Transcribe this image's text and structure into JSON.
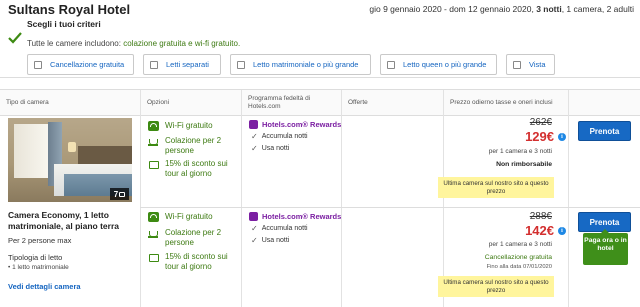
{
  "header": {
    "hotel_name": "Sultans Royal Hotel",
    "dates": "gio 9 gennaio 2020 - dom 12 gennaio 2020,",
    "nights": "3 notti",
    "rooms_guests": ", 1 camera, 2 adulti"
  },
  "criteria": {
    "title": "Scegli i tuoi criteri",
    "subtitle_prefix": "Tutte le camere includono:",
    "subtitle_included": "colazione gratuita e wi-fi gratuito.",
    "filters": [
      {
        "label": "Cancellazione gratuita"
      },
      {
        "label": "Letti separati"
      },
      {
        "label": "Letto matrimoniale o più grande"
      },
      {
        "label": "Letto queen o più grande"
      },
      {
        "label": "Vista"
      }
    ]
  },
  "table": {
    "headers": {
      "room_type": "Tipo di camera",
      "options": "Opzioni",
      "loyalty": "Programma fedeltà di Hotels.com",
      "offers": "Offerte",
      "price": "Prezzo odierno tasse e oneri inclusi"
    }
  },
  "room": {
    "photo_count": "7",
    "name": "Camera Economy, 1 letto matrimoniale, al piano terra",
    "people": "Per 2 persone max",
    "bed_type_title": "Tipologia di letto",
    "bed_type_item": "• 1 letto matrimoniale",
    "details_link": "Vedi dettagli camera"
  },
  "offers": [
    {
      "options": [
        "Wi-Fi gratuito",
        "Colazione per 2 persone",
        "15% di sconto sui tour al giorno"
      ],
      "loyalty_name": "Hotels.com® Rewards",
      "loyalty_items": [
        "Accumula notti",
        "Usa notti"
      ],
      "old_price": "262€",
      "new_price": "129€",
      "per": "per 1 camera e 3 notti",
      "note": "Non rimborsabile",
      "last_room": "Ultima camera sul nostro sito a questo prezzo",
      "button": "Prenota"
    },
    {
      "options": [
        "Wi-Fi gratuito",
        "Colazione per 2 persone",
        "15% di sconto sui tour al giorno"
      ],
      "loyalty_name": "Hotels.com® Rewards",
      "loyalty_items": [
        "Accumula notti",
        "Usa notti"
      ],
      "old_price": "288€",
      "new_price": "142€",
      "per": "per 1 camera e 3 notti",
      "cancel": "Cancellazione gratuita",
      "until": "Fino alla data 07/01/2020",
      "last_room": "Ultima camera sul nostro sito a questo prezzo",
      "button": "Prenota",
      "pay_tip": "Paga ora o in hotel"
    }
  ],
  "colors": {
    "accent_blue": "#1769c4",
    "price_red": "#d32f2f",
    "green": "#3d7a12",
    "highlight_yellow": "#fff59d",
    "rewards_purple": "#7b1fa2"
  }
}
